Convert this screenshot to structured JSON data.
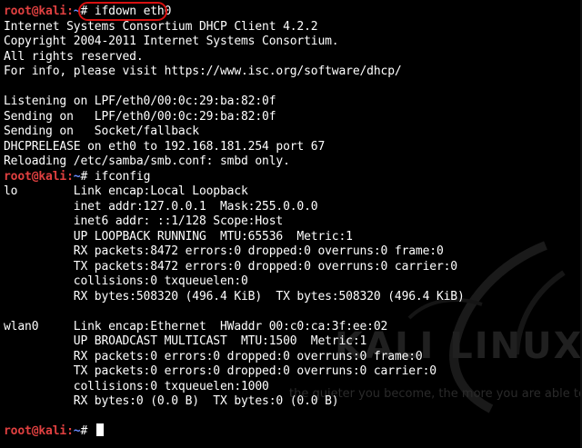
{
  "terminal": {
    "prompt": {
      "user": "root@kali",
      "sep": ":",
      "path": "~",
      "symbol": "#"
    },
    "commands": {
      "first": " ifdown eth0",
      "second": " ifconfig"
    },
    "output1": [
      "Internet Systems Consortium DHCP Client 4.2.2",
      "Copyright 2004-2011 Internet Systems Consortium.",
      "All rights reserved.",
      "For info, please visit https://www.isc.org/software/dhcp/",
      "",
      "Listening on LPF/eth0/00:0c:29:ba:82:0f",
      "Sending on   LPF/eth0/00:0c:29:ba:82:0f",
      "Sending on   Socket/fallback",
      "DHCPRELEASE on eth0 to 192.168.181.254 port 67",
      "Reloading /etc/samba/smb.conf: smbd only."
    ],
    "output2": [
      "lo        Link encap:Local Loopback",
      "          inet addr:127.0.0.1  Mask:255.0.0.0",
      "          inet6 addr: ::1/128 Scope:Host",
      "          UP LOOPBACK RUNNING  MTU:65536  Metric:1",
      "          RX packets:8472 errors:0 dropped:0 overruns:0 frame:0",
      "          TX packets:8472 errors:0 dropped:0 overruns:0 carrier:0",
      "          collisions:0 txqueuelen:0",
      "          RX bytes:508320 (496.4 KiB)  TX bytes:508320 (496.4 KiB)",
      "",
      "wlan0     Link encap:Ethernet  HWaddr 00:c0:ca:3f:ee:02",
      "          UP BROADCAST MULTICAST  MTU:1500  Metric:1",
      "          RX packets:0 errors:0 dropped:0 overruns:0 frame:0",
      "          TX packets:0 errors:0 dropped:0 overruns:0 carrier:0",
      "          collisions:0 txqueuelen:1000",
      "          RX bytes:0 (0.0 B)  TX bytes:0 (0.0 B)",
      ""
    ]
  },
  "watermark": {
    "title": "KALI LINUX",
    "tagline": "the quieter you become, the more you are able to hear."
  },
  "colors": {
    "background": "#000000",
    "text": "#ffffff",
    "prompt_red": "#e04040",
    "prompt_path_blue": "#6a8cff",
    "annotation_red": "#d81010"
  }
}
